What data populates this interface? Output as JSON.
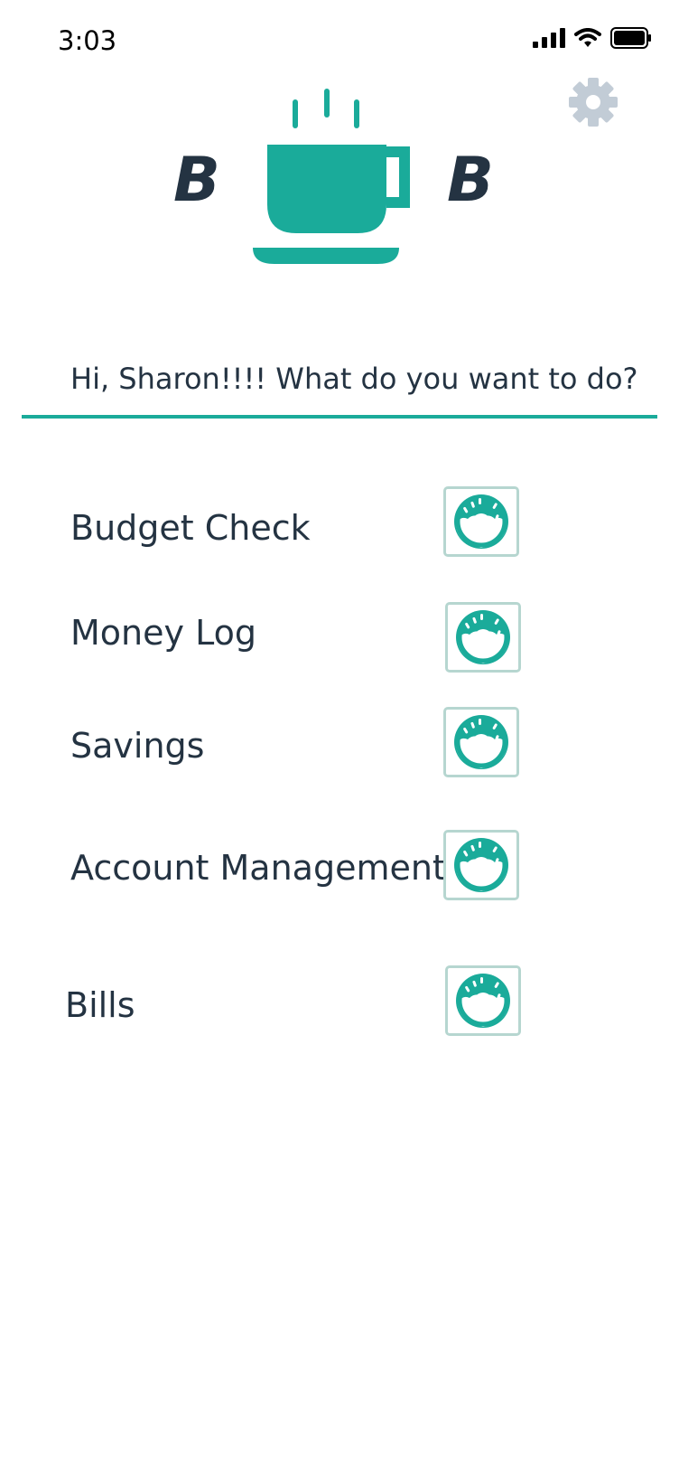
{
  "status_bar": {
    "time": "3:03"
  },
  "logo": {
    "left_letter": "B",
    "right_letter": "B"
  },
  "greeting": "Hi, Sharon!!!!  What do you want to do?",
  "menu": [
    {
      "label": "Budget Check",
      "icon": "donut-icon"
    },
    {
      "label": "Money Log",
      "icon": "donut-icon"
    },
    {
      "label": "Savings",
      "icon": "donut-icon"
    },
    {
      "label": "Account Management",
      "icon": "donut-icon"
    },
    {
      "label": "Bills",
      "icon": "donut-icon"
    }
  ],
  "colors": {
    "accent": "#1aab9a",
    "text": "#243342",
    "gear": "#c2ccd6",
    "button_border": "#b6d6d0"
  }
}
